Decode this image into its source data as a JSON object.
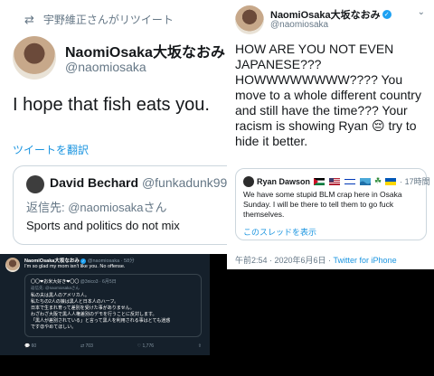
{
  "colors": {
    "link": "#1b95e0",
    "verified": "#1da1f2",
    "dark_bg": "#15202b"
  },
  "tweet1": {
    "retweet_label": "宇野維正さんがリツイート",
    "name": "NaomiOsaka大坂なおみ",
    "handle": "@naomiosaka",
    "text": "I hope that fish eats you.",
    "translate": "ツイートを翻訳",
    "quote": {
      "name": "David Bechard",
      "handle": "@funkadunk99",
      "reply_prefix": "返信先: ",
      "reply_mention": "@naomiosakaさん",
      "text": "Sports and politics do not mix"
    }
  },
  "tweet2": {
    "name": "NaomiOsaka大坂なおみ",
    "handle": "@naomiosaka",
    "text_before_emoji": "HOW ARE YOU NOT EVEN JAPANESE??? HOWWWWWWWW???? You move to a whole different country and still have the time??? Your racism is showing Ryan",
    "emoji": "😔",
    "text_after_emoji": " try to hide it better.",
    "quote": {
      "name": "Ryan Dawson",
      "time": "· 17時間",
      "text": "We have some stupid BLM crap here in Osaka Sunday. I will be there to tell them to go fuck themselves.",
      "thread_link": "このスレッドを表示"
    },
    "timestamp": "午前2:54 · 2020年6月6日 · ",
    "source": "Twitter for iPhone"
  },
  "tweet3": {
    "name": "NaomiOsaka大坂なおみ",
    "handle_time": "@naomiosaka · 58分",
    "text": "I'm so glad my mom isn't like you. No offense.",
    "quote": {
      "name": "〇〇❤お米大好き❤〇〇",
      "handle": "@3nico3 · 6月5日",
      "reply": "返信先: @naomiosakaさん",
      "lines": [
        "私の夫は黒人のアメリカ人。",
        "私たちの2人の娘は黒人と日本人のハーフ。",
        "日本で生まれ育って差別を受けた事がありません。",
        "わざわざ大阪で黒人人権差別のデモを行うことに反対します。",
        "「黒人が差別されている」と言って黒人を利用される事はとても迷惑",
        "です😡やめてほしい。"
      ]
    },
    "replies": "60",
    "retweets": "703",
    "likes": "1,776"
  }
}
